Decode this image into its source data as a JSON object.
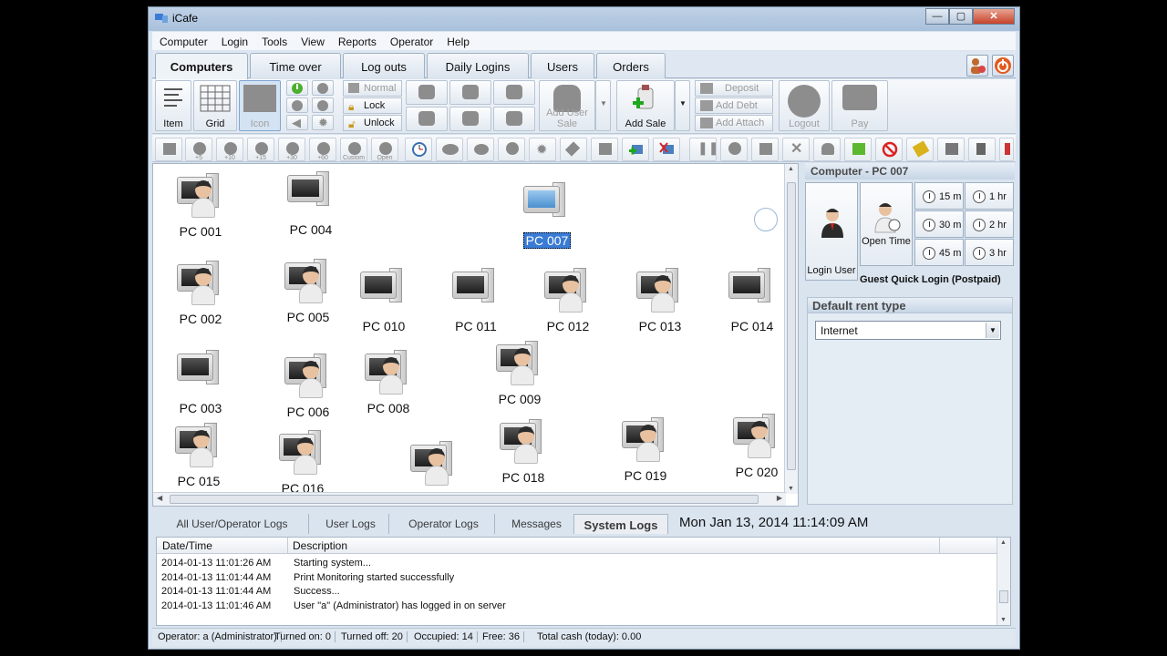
{
  "window": {
    "title": "iCafe"
  },
  "menu": [
    "Computer",
    "Login",
    "Tools",
    "View",
    "Reports",
    "Operator",
    "Help"
  ],
  "tabs": [
    "Computers",
    "Time over",
    "Log outs",
    "Daily Logins",
    "Users",
    "Orders"
  ],
  "ribbon": {
    "view_item": "Item",
    "view_grid": "Grid",
    "view_icon": "Icon",
    "normal": "Normal",
    "lock": "Lock",
    "unlock": "Unlock",
    "add_user_sale": "Add User Sale",
    "add_sale": "Add Sale",
    "deposit": "Deposit",
    "add_debt": "Add Debt",
    "add_attach": "Add Attach",
    "logout": "Logout",
    "pay": "Pay"
  },
  "toolbar2_labels": [
    "+5",
    "+10",
    "+15",
    "+30",
    "+60",
    "Custom",
    "Open"
  ],
  "computers": [
    {
      "name": "PC 001",
      "occupied": true
    },
    {
      "name": "PC 004",
      "occupied": false
    },
    {
      "name": "PC 007",
      "occupied": false,
      "selected": true
    },
    {
      "name": "PC 002",
      "occupied": true
    },
    {
      "name": "PC 005",
      "occupied": true
    },
    {
      "name": "PC 010",
      "occupied": false
    },
    {
      "name": "PC 011",
      "occupied": false
    },
    {
      "name": "PC 012",
      "occupied": true
    },
    {
      "name": "PC 013",
      "occupied": true
    },
    {
      "name": "PC 014",
      "occupied": false
    },
    {
      "name": "PC 003",
      "occupied": false
    },
    {
      "name": "PC 006",
      "occupied": true
    },
    {
      "name": "PC 008",
      "occupied": true
    },
    {
      "name": "PC 009",
      "occupied": true
    },
    {
      "name": "PC 015",
      "occupied": true
    },
    {
      "name": "PC 016",
      "occupied": true
    },
    {
      "name": "",
      "occupied": true
    },
    {
      "name": "PC 018",
      "occupied": true
    },
    {
      "name": "PC 019",
      "occupied": true
    },
    {
      "name": "PC 020",
      "occupied": true
    }
  ],
  "panel": {
    "title": "Computer - PC 007",
    "login_user": "Login User",
    "open_time": "Open Time",
    "times": [
      "15 m",
      "1 hr",
      "30 m",
      "2 hr",
      "45 m",
      "3 hr"
    ],
    "guest_label": "Guest Quick Login (Postpaid)",
    "rent_type_title": "Default rent type",
    "rent_type_value": "Internet"
  },
  "log_tabs": [
    "All User/Operator Logs",
    "User Logs",
    "Operator Logs",
    "Messages",
    "System Logs"
  ],
  "datetime": "Mon Jan 13, 2014   11:14:09 AM",
  "log_columns": [
    "Date/Time",
    "Description"
  ],
  "logs": [
    {
      "time": "2014-01-13 11:01:26 AM",
      "desc": "Starting system..."
    },
    {
      "time": "2014-01-13 11:01:44 AM",
      "desc": "Print Monitoring started successfully"
    },
    {
      "time": "2014-01-13 11:01:44 AM",
      "desc": "Success..."
    },
    {
      "time": "2014-01-13 11:01:46 AM",
      "desc": "User \"a\" (Administrator) has logged in on server"
    }
  ],
  "status": {
    "operator": "Operator: a (Administrator)",
    "turned_on": "Turned on: 0",
    "turned_off": "Turned off: 20",
    "occupied": "Occupied: 14",
    "free": "Free: 36",
    "cash": "Total cash (today): 0.00"
  }
}
